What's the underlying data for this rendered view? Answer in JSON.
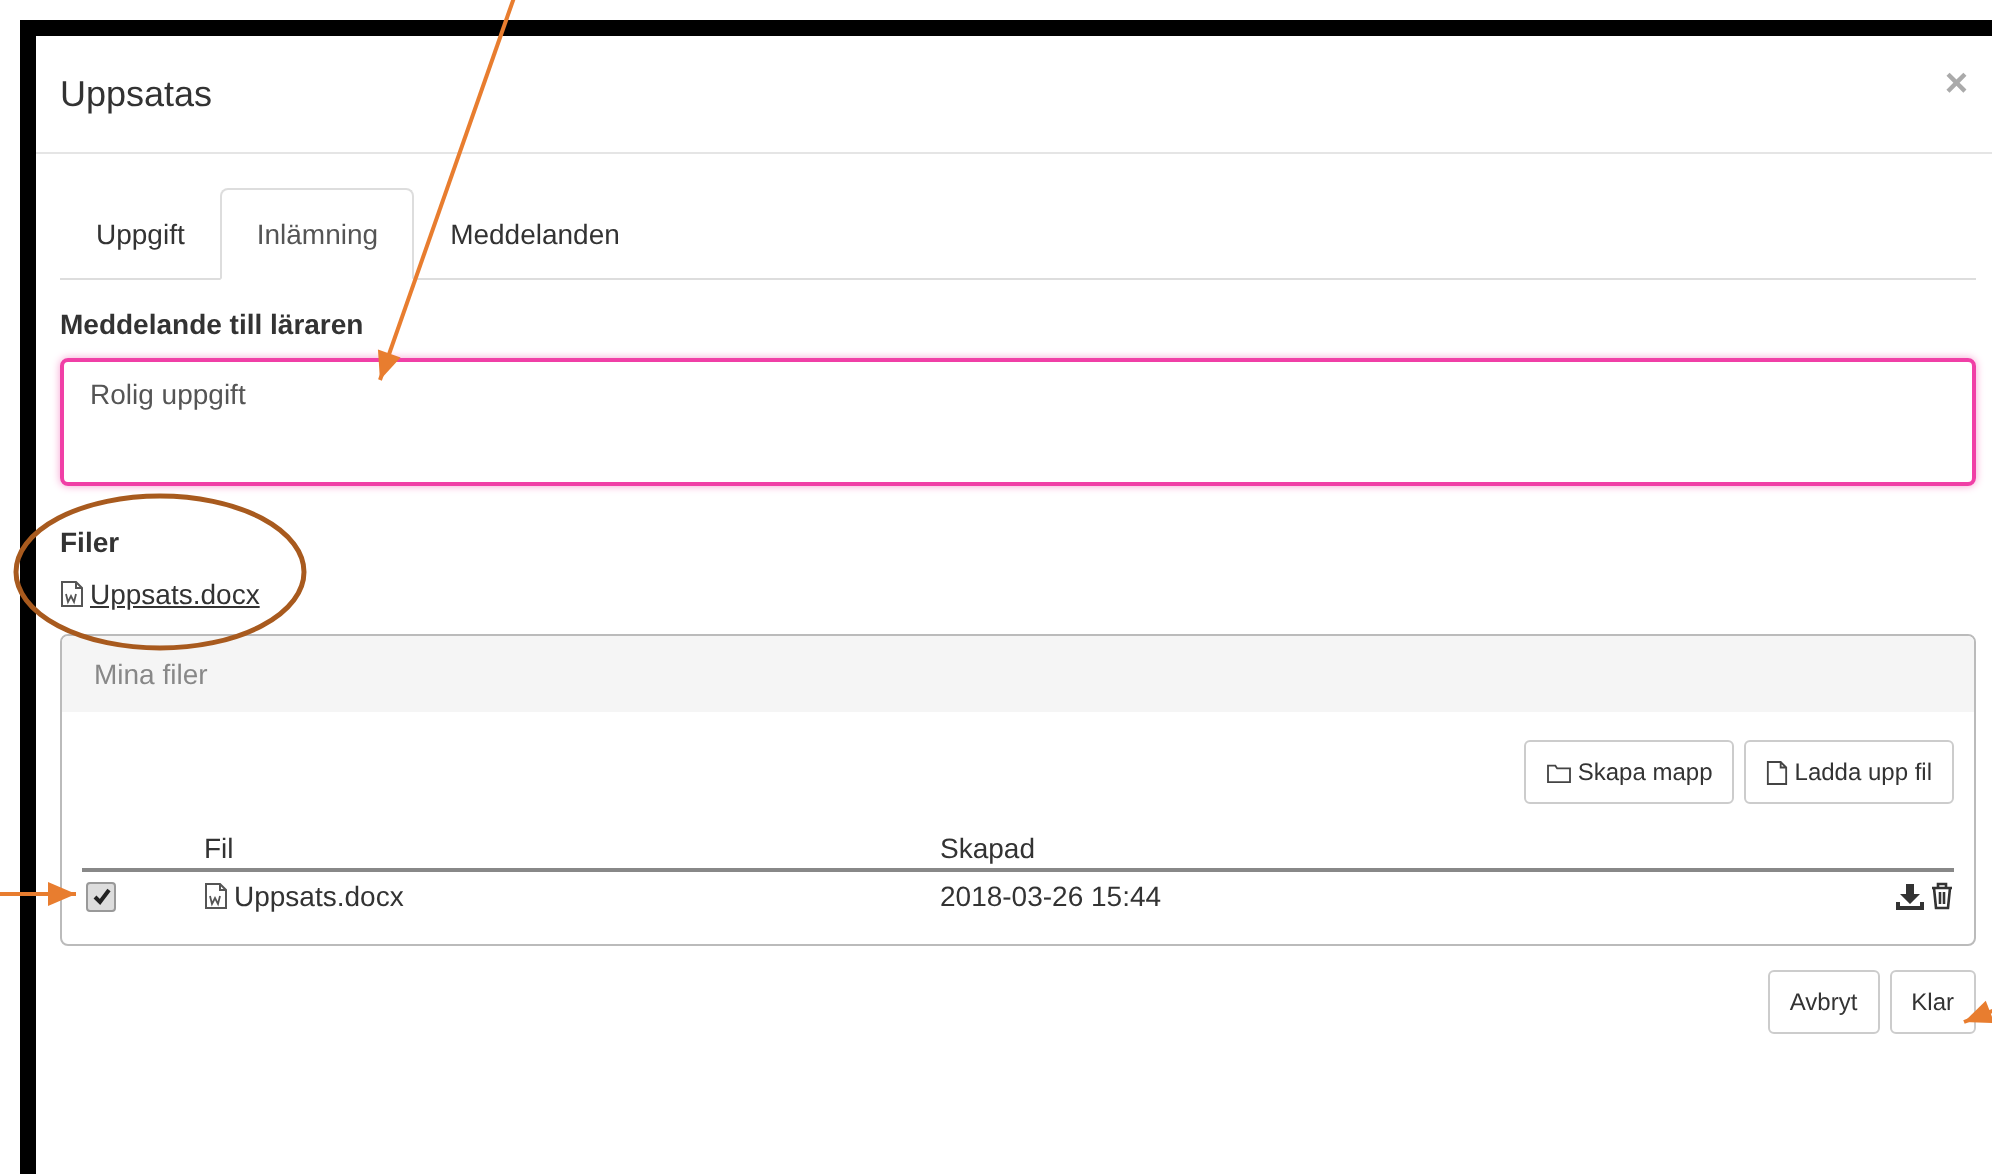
{
  "dialog": {
    "title": "Uppsatas",
    "close": "×"
  },
  "tabs": [
    {
      "label": "Uppgift",
      "selected": false
    },
    {
      "label": "Inlämning",
      "selected": true
    },
    {
      "label": "Meddelanden",
      "selected": false
    }
  ],
  "message": {
    "label": "Meddelande till läraren",
    "value": "Rolig uppgift"
  },
  "files": {
    "label": "Filer",
    "items": [
      "Uppsats.docx"
    ]
  },
  "panel": {
    "title": "Mina filer",
    "buttons": [
      "Skapa mapp",
      "Ladda upp fil"
    ],
    "columns": [
      "Fil",
      "Skapad"
    ],
    "rows": [
      {
        "name": "Uppsats.docx",
        "created": "2018-03-26 15:44",
        "checked": true
      }
    ]
  },
  "footer_buttons": [
    "Avbryt",
    "Klar"
  ],
  "annotations": [
    {
      "kind": "arrow",
      "color": "#e87d2f"
    },
    {
      "kind": "ellipse",
      "color": "#a85a1e"
    },
    {
      "kind": "arrow",
      "color": "#e87d2f"
    },
    {
      "kind": "arrow",
      "color": "#e87d2f"
    }
  ]
}
